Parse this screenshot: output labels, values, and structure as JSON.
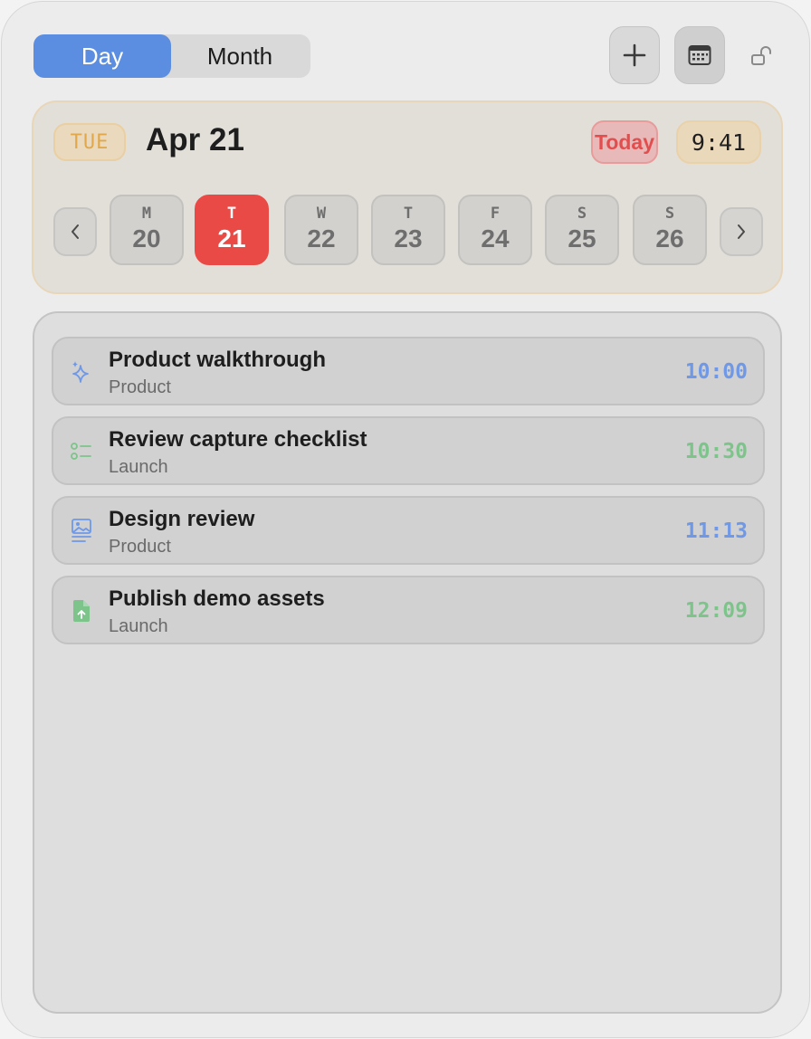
{
  "view_switch": {
    "options": [
      {
        "label": "Day",
        "selected": true
      },
      {
        "label": "Month",
        "selected": false
      }
    ]
  },
  "toolbar": {
    "add_icon": "plus-icon",
    "calendar_icon": "calendar-icon",
    "lock_icon": "unlock-icon"
  },
  "header": {
    "weekday_badge": "TUE",
    "date_title": "Apr 21",
    "today_label": "Today",
    "time": "9:41"
  },
  "week": {
    "prev_icon": "chevron-left-icon",
    "next_icon": "chevron-right-icon",
    "days": [
      {
        "letter": "M",
        "number": "20",
        "selected": false
      },
      {
        "letter": "T",
        "number": "21",
        "selected": true
      },
      {
        "letter": "W",
        "number": "22",
        "selected": false
      },
      {
        "letter": "T",
        "number": "23",
        "selected": false
      },
      {
        "letter": "F",
        "number": "24",
        "selected": false
      },
      {
        "letter": "S",
        "number": "25",
        "selected": false
      },
      {
        "letter": "S",
        "number": "26",
        "selected": false
      }
    ]
  },
  "events": [
    {
      "title": "Product walkthrough",
      "category": "Product",
      "time": "10:00",
      "icon": "sparkles-icon",
      "color": "#6f98e6"
    },
    {
      "title": "Review capture checklist",
      "category": "Launch",
      "time": "10:30",
      "icon": "checklist-icon",
      "color": "#7cc48a"
    },
    {
      "title": "Design review",
      "category": "Product",
      "time": "11:13",
      "icon": "image-doc-icon",
      "color": "#6f98e6"
    },
    {
      "title": "Publish demo assets",
      "category": "Launch",
      "time": "12:09",
      "icon": "file-upload-icon",
      "color": "#7cc48a"
    }
  ],
  "colors": {
    "accent_blue": "#5b8ee0",
    "today_red": "#ea4a46",
    "weekday_orange": "#e1a84b"
  }
}
